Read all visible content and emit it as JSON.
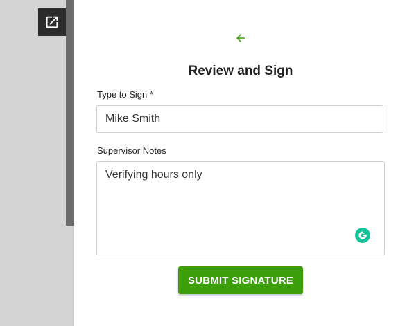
{
  "sidebar": {
    "open_external_icon": "open-in-new-icon"
  },
  "form": {
    "back_icon": "arrow-left-icon",
    "title": "Review and Sign",
    "sign_label": "Type to Sign",
    "sign_required_mark": "*",
    "sign_value": "Mike Smith",
    "notes_label": "Supervisor Notes",
    "notes_value": "Verifying hours only",
    "grammarly_icon": "grammarly-icon",
    "submit_label": "SUBMIT SIGNATURE"
  },
  "colors": {
    "accent_green": "#3b9e0a",
    "back_arrow_green": "#3b9e0a",
    "grammarly_teal": "#15c39a"
  }
}
